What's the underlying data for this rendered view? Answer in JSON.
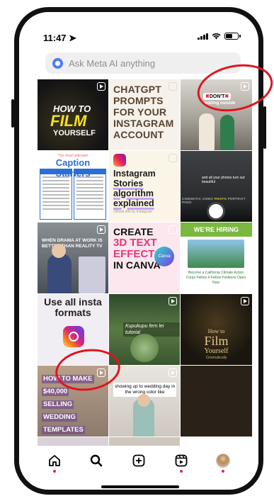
{
  "status": {
    "time": "11:47"
  },
  "search": {
    "placeholder": "Ask Meta AI anything"
  },
  "tiles": {
    "t1": {
      "line1": "HOW TO",
      "line2": "FILM",
      "line3": "YOURSELF"
    },
    "t2": {
      "lines": [
        "CHATGPT",
        "PROMPTS",
        "FOR YOUR",
        "INSTAGRAM",
        "ACCOUNT"
      ]
    },
    "t3": {
      "badge": "DON'T",
      "sub": "wedding outside"
    },
    "t4": {
      "head1": "The most unknown",
      "head2": "Caption Starters"
    },
    "t5": {
      "l1": "Instagram",
      "l2": "Stories",
      "l3": "algorithm",
      "l4": "explained",
      "by": "Official info by Instagram"
    },
    "t6": {
      "caption": "and all your photos turn out beautiful",
      "modes_pre": "CINEMATIC  VIDEO  ",
      "modes_active": "PHOTO",
      "modes_post": "  PORTRAIT  PANO"
    },
    "t7": {
      "caption": "WHEN DRAMA AT WORK IS BETTER THAN REALITY TV"
    },
    "t8": {
      "l1": "CREATE",
      "l2": "3D TEXT",
      "l3": "EFFECTS",
      "l4": "IN CANVA",
      "badge": "Canva"
    },
    "t9": {
      "tag": "WE'RE HIRING",
      "sub": "Become a California Climate Action Corps Fellow 4 Fellow Positions Open Now"
    },
    "t10": {
      "title": "Use all insta formats"
    },
    "t11": {
      "caption": "Kupukupu fern lei tutorial"
    },
    "t12": {
      "how": "How to",
      "film": "Film",
      "yourself": "Yourself",
      "cine": "Cinematically"
    },
    "t13": {
      "lines": [
        "HOW TO MAKE",
        "$40,000",
        "SELLING",
        "WEDDING",
        "TEMPLATES"
      ]
    },
    "t14": {
      "caption": "showing up to wedding day in the wrong color like"
    }
  },
  "nav": {
    "items": [
      {
        "name": "home-icon"
      },
      {
        "name": "search-icon"
      },
      {
        "name": "add-post-icon"
      },
      {
        "name": "reels-icon"
      },
      {
        "name": "profile-avatar"
      }
    ]
  },
  "colors": {
    "accent": "#e0245e",
    "annotation": "#e0141e"
  }
}
